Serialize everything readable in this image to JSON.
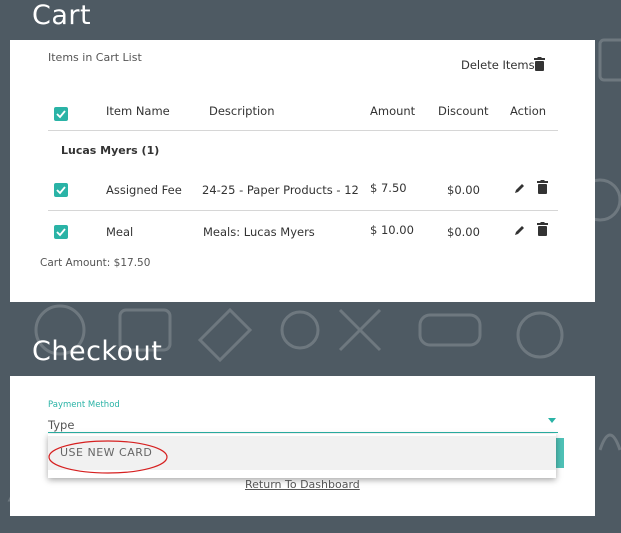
{
  "cart": {
    "title": "Cart",
    "list_title": "Items in Cart List",
    "delete_items_label": "Delete Items",
    "columns": [
      "Item Name",
      "Description",
      "Amount",
      "Discount",
      "Action"
    ],
    "group_label": "Lucas Myers (1)",
    "rows": [
      {
        "name": "Assigned Fee",
        "description": "24-25 - Paper Products - 12",
        "amount": "$ 7.50",
        "discount": "$0.00"
      },
      {
        "name": "Meal",
        "description": "Meals: Lucas Myers",
        "amount": "$ 10.00",
        "discount": "$0.00"
      }
    ],
    "cart_amount": "Cart Amount: $17.50"
  },
  "checkout": {
    "title": "Checkout",
    "payment_method_label": "Payment Method",
    "type_placeholder": "Type",
    "dropdown_option": "USE NEW CARD",
    "return_link": "Return To Dashboard"
  },
  "colors": {
    "background": "#4e5a63",
    "accent": "#2ab3a6",
    "annotation": "#d62020"
  },
  "icons": [
    "trash-icon",
    "pencil-icon",
    "checkmark-icon",
    "caret-down-icon"
  ]
}
